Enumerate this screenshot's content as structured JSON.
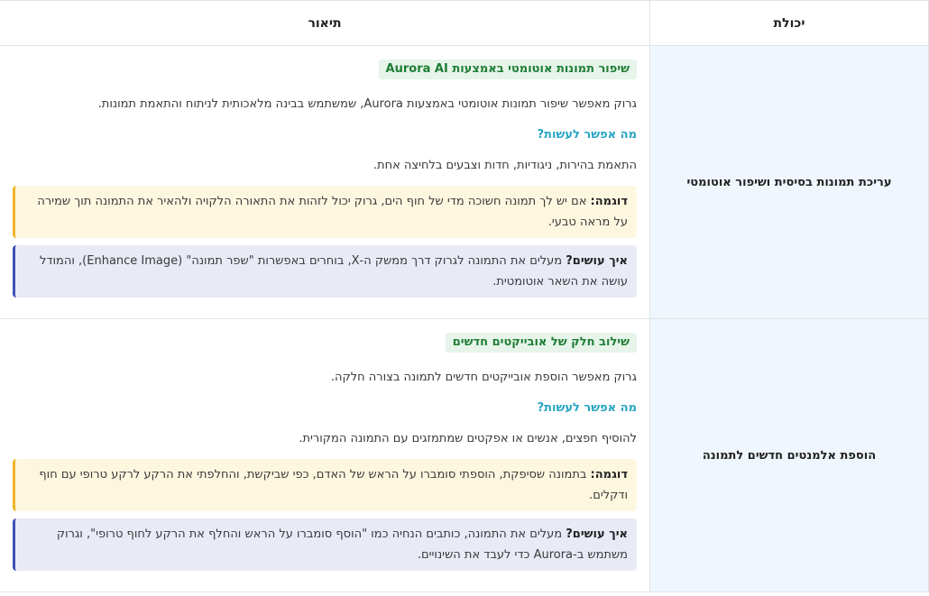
{
  "table": {
    "headers": {
      "capability": "יכולת",
      "description": "תיאור"
    },
    "rows": [
      {
        "capability": "עריכת תמונות בסיסית ושיפור אוטומטי",
        "tag": "שיפור תמונות אוטומטי באמצעות Aurora AI",
        "intro": "גרוק מאפשר שיפור תמונות אוטומטי באמצעות Aurora, שמשתמש בבינה מלאכותית לניתוח והתאמת תמונות.",
        "question": "מה אפשר לעשות?",
        "answer": "התאמת בהירות, ניגודיות, חדות וצבעים בלחיצה אחת.",
        "example_label": "דוגמה:",
        "example_text": "אם יש לך תמונה חשוכה מדי של חוף הים, גרוק יכול לזהות את התאורה הלקויה ולהאיר את התמונה תוך שמירה על מראה טבעי.",
        "how_label": "איך עושים?",
        "how_text": "מעלים את התמונה לגרוק דרך ממשק ה-X, בוחרים באפשרות \"שפר תמונה\" (Enhance Image), והמודל עושה את השאר אוטומטית."
      },
      {
        "capability": "הוספת אלמנטים חדשים לתמונה",
        "tag": "שילוב חלק של אובייקטים חדשים",
        "intro": "גרוק מאפשר הוספת אובייקטים חדשים לתמונה בצורה חלקה.",
        "question": "מה אפשר לעשות?",
        "answer": "להוסיף חפצים, אנשים או אפקטים שמתמזגים עם התמונה המקורית.",
        "example_label": "דוגמה:",
        "example_text": "בתמונה שסיפקת, הוספתי סומברו על הראש של האדם, כפי שביקשת, והחלפתי את הרקע לרקע טרופי עם חוף ודקלים.",
        "how_label": "איך עושים?",
        "how_text": "מעלים את התמונה, כותבים הנחיה כמו \"הוסף סומברו על הראש והחלף את הרקע לחוף טרופי\", וגרוק משתמש ב-Aurora כדי לעבד את השינויים."
      }
    ]
  },
  "colors": {
    "tag_bg": "#e6f4ea",
    "tag_text": "#1e7e34",
    "question": "#27a4c4",
    "example_bg": "#fef7e0",
    "example_border": "#f0b429",
    "how_bg": "#e8eaf6",
    "how_border": "#3f51b5",
    "capability_bg": "#f0f6fd"
  }
}
